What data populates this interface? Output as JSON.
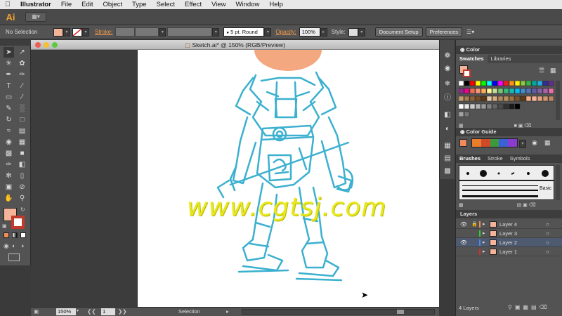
{
  "menubar": {
    "app_name": "Illustrator",
    "items": [
      "File",
      "Edit",
      "Object",
      "Type",
      "Select",
      "Effect",
      "View",
      "Window",
      "Help"
    ]
  },
  "appbar": {
    "logo": "Ai"
  },
  "control_bar": {
    "selection_label": "No Selection",
    "stroke_label": "Stroke:",
    "brush_value": "5 pt. Round",
    "opacity_label": "Opacity:",
    "opacity_value": "100%",
    "style_label": "Style:",
    "document_setup_label": "Document Setup",
    "preferences_label": "Preferences",
    "fill_color": "#f4b49a",
    "stroke_color": "#c0392b"
  },
  "document": {
    "tab_title": "Sketch.ai* @ 150% (RGB/Preview)",
    "watermark": "www.cgtsj.com",
    "sketch_color": "#3bb0cf",
    "head_color": "#f3a880"
  },
  "status_bar": {
    "zoom": "150%",
    "artboard_number": "1",
    "tool_label": "Selection"
  },
  "panels": {
    "color": {
      "title": "Color"
    },
    "swatches": {
      "tabs": [
        "Swatches",
        "Libraries"
      ]
    },
    "color_guide": {
      "title": "Color Guide"
    },
    "brushes": {
      "tabs": [
        "Brushes",
        "Stroke",
        "Symbols"
      ],
      "basic_label": "Basic"
    },
    "layers": {
      "title": "Layers",
      "count_label": "4 Layers",
      "items": [
        {
          "name": "Layer 4",
          "color": "#f08c5a",
          "visible": false,
          "locked": true
        },
        {
          "name": "Layer 3",
          "color": "#33cc33",
          "visible": false,
          "locked": false
        },
        {
          "name": "Layer 2",
          "color": "#4a8af0",
          "visible": true,
          "locked": false,
          "selected": true
        },
        {
          "name": "Layer 1",
          "color": "#d03030",
          "visible": false,
          "locked": false
        }
      ]
    }
  },
  "tools_panel": {
    "fill_color": "#f4b49a",
    "stroke_color": "#c0392b"
  }
}
